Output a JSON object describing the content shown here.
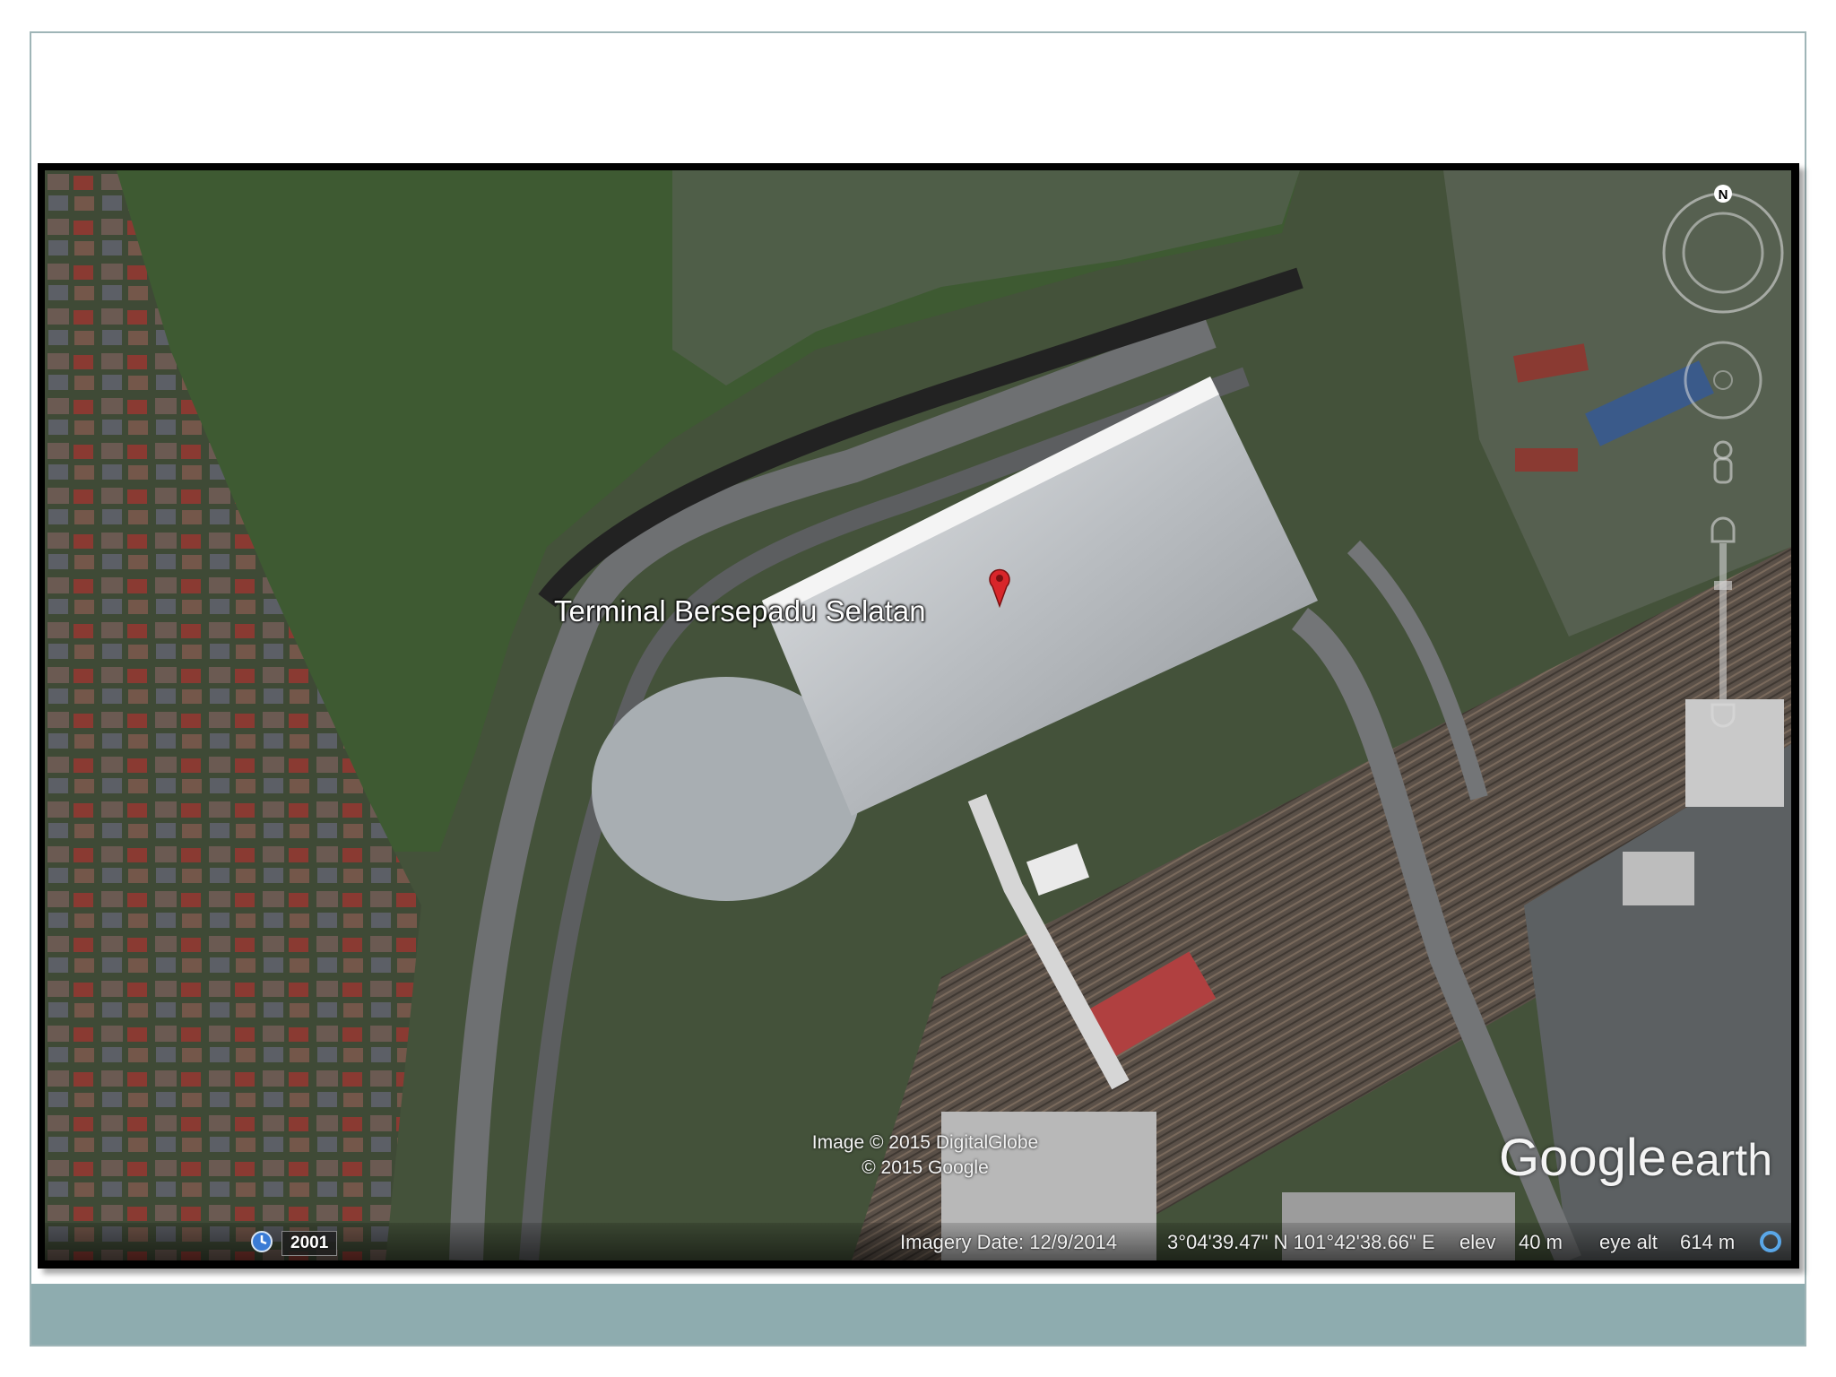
{
  "map": {
    "place_label": "Terminal Bersepadu Selatan",
    "credits_line1": "Image © 2015 DigitalGlobe",
    "credits_line2": "© 2015 Google",
    "logo_google": "Google",
    "logo_earth": "earth",
    "compass_letter": "N",
    "status": {
      "year": "2001",
      "imagery_date": "Imagery Date: 12/9/2014",
      "coordinates": "3°04'39.47\" N  101°42'38.66\" E",
      "elev_label": "elev",
      "elev_value": "40 m",
      "eye_alt_label": "eye alt",
      "eye_alt_value": "614 m"
    },
    "icons": [
      "placemark-pin-icon",
      "clock-icon",
      "compass-icon",
      "look-joystick-icon",
      "move-joystick-icon",
      "street-view-pegman-icon",
      "zoom-slider-icon",
      "streaming-status-icon"
    ]
  },
  "colors": {
    "footer_band": "#8eacaf",
    "slide_border": "#9fb5b7",
    "pin": "#d8262a"
  }
}
